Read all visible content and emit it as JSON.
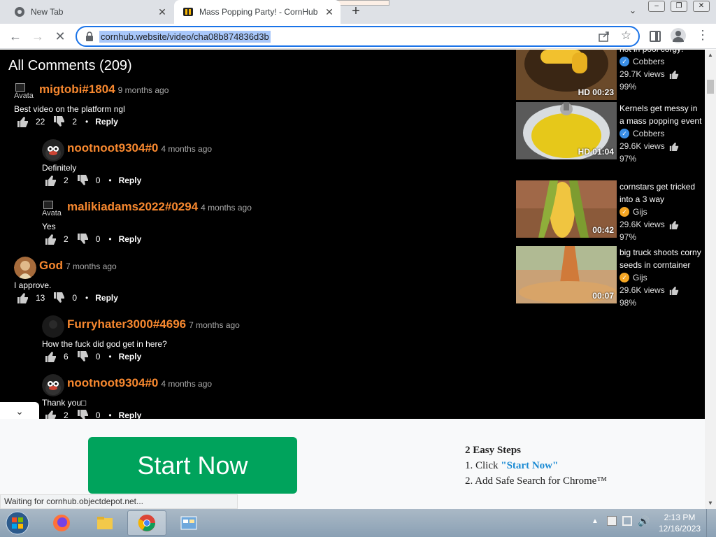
{
  "tabs": [
    {
      "label": "New Tab",
      "active": false
    },
    {
      "label": "Mass Popping Party! - CornHub",
      "active": true
    }
  ],
  "toolbar": {
    "url": "cornhub.website/video/cha08b874836d3b"
  },
  "comments": {
    "title": "All Comments (209)",
    "items": [
      {
        "user": "migtobi#1804",
        "time": "9 months ago",
        "text": "Best video on the platform ngl",
        "likes": "22",
        "dislikes": "2",
        "reply": "Reply",
        "avatar_alt": "Avata",
        "avatar": "broken",
        "indent": false
      },
      {
        "user": "nootnoot9304#0",
        "time": "4 months ago",
        "text": "Definitely",
        "likes": "2",
        "dislikes": "0",
        "reply": "Reply",
        "avatar": "pingu",
        "indent": true
      },
      {
        "user": "malikiadams2022#0294",
        "time": "4 months ago",
        "text": "Yes",
        "likes": "2",
        "dislikes": "0",
        "reply": "Reply",
        "avatar_alt": "Avata",
        "avatar": "broken",
        "indent": true
      },
      {
        "user": "God",
        "time": "7 months ago",
        "text": "I approve.",
        "likes": "13",
        "dislikes": "0",
        "reply": "Reply",
        "avatar": "god",
        "indent": false
      },
      {
        "user": "Furryhater3000#4696",
        "time": "7 months ago",
        "text": "How the fuck did god get in here?",
        "likes": "6",
        "dislikes": "0",
        "reply": "Reply",
        "avatar": "dark",
        "indent": true
      },
      {
        "user": "nootnoot9304#0",
        "time": "4 months ago",
        "text": "Thank you□",
        "likes": "2",
        "dislikes": "0",
        "reply": "Reply",
        "avatar": "pingu",
        "indent": true
      }
    ]
  },
  "videos": [
    {
      "title": "hot in pool corgy!",
      "channel": "Cobbers",
      "channel_badge": "blue",
      "views": "29.7K views",
      "rating": "99%",
      "duration": "HD 00:23"
    },
    {
      "title": "Kernels get messy in a mass popping event",
      "channel": "Cobbers",
      "channel_badge": "blue",
      "views": "29.6K views",
      "rating": "97%",
      "duration": "HD 01:04"
    },
    {
      "title": "cornstars get tricked into a 3 way",
      "channel": "Gijs",
      "channel_badge": "orange",
      "views": "29.6K views",
      "rating": "97%",
      "duration": "00:42"
    },
    {
      "title": "big truck shoots corny seeds in corntainer",
      "channel": "Gijs",
      "channel_badge": "orange",
      "views": "29.6K views",
      "rating": "98%",
      "duration": "00:07"
    }
  ],
  "ad": {
    "button": "Start Now",
    "heading": "2 Easy Steps",
    "step1_prefix": "1. Click ",
    "step1_link": "\"Start Now\"",
    "step2": "2. Add Safe Search for Chrome™"
  },
  "status": "Waiting for cornhub.objectdepot.net...",
  "clock": {
    "time": "2:13 PM",
    "date": "12/16/2023"
  },
  "colors": {
    "accent_orange": "#f7882f",
    "ad_green": "#00a35c",
    "omnibox_blue": "#1a73e8"
  }
}
